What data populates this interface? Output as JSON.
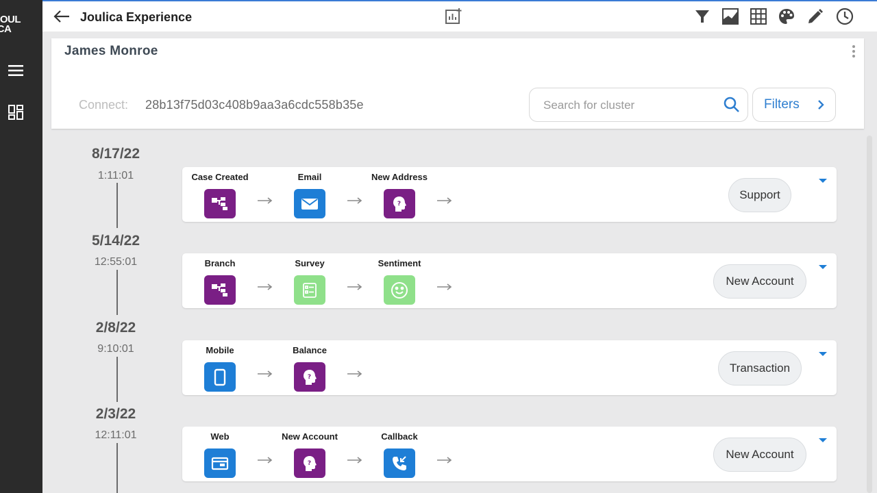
{
  "app": {
    "logo_lines": [
      "JOUL",
      "ICA"
    ],
    "title": "Joulica Experience"
  },
  "header": {
    "person_name": "James Monroe",
    "connect_label": "Connect:",
    "connect_id": "28b13f75d03c408b9aa3a6cdc558b35e",
    "search_placeholder": "Search for cluster",
    "filters_label": "Filters"
  },
  "toolbar_icons": [
    "filter-icon",
    "area-chart-icon",
    "grid-icon",
    "palette-icon",
    "pencil-icon",
    "clock-icon"
  ],
  "colors": {
    "purple": "#7a1f85",
    "blue": "#1e7ed6",
    "green": "#8fe08a",
    "rail": "#2b2b2b",
    "accent": "#2f7fd0"
  },
  "timeline": [
    {
      "date": "8/17/22",
      "time": "1:11:01",
      "tag": "Support",
      "steps": [
        {
          "label": "Case Created",
          "icon": "branch-icon",
          "color": "#7a1f85"
        },
        {
          "label": "Email",
          "icon": "envelope-icon",
          "color": "#1e7ed6"
        },
        {
          "label": "New Address",
          "icon": "head-question-icon",
          "color": "#7a1f85"
        }
      ]
    },
    {
      "date": "5/14/22",
      "time": "12:55:01",
      "tag": "New Account",
      "steps": [
        {
          "label": "Branch",
          "icon": "branch-icon",
          "color": "#7a1f85"
        },
        {
          "label": "Survey",
          "icon": "survey-icon",
          "color": "#8fe08a"
        },
        {
          "label": "Sentiment",
          "icon": "smiley-icon",
          "color": "#8fe08a"
        }
      ]
    },
    {
      "date": "2/8/22",
      "time": "9:10:01",
      "tag": "Transaction",
      "steps": [
        {
          "label": "Mobile",
          "icon": "mobile-icon",
          "color": "#1e7ed6"
        },
        {
          "label": "Balance",
          "icon": "head-question-icon",
          "color": "#7a1f85"
        }
      ]
    },
    {
      "date": "2/3/22",
      "time": "12:11:01",
      "tag": "New Account",
      "steps": [
        {
          "label": "Web",
          "icon": "browser-icon",
          "color": "#1e7ed6"
        },
        {
          "label": "New Account",
          "icon": "head-question-icon",
          "color": "#7a1f85"
        },
        {
          "label": "Callback",
          "icon": "phone-callback-icon",
          "color": "#1e7ed6"
        }
      ]
    }
  ]
}
